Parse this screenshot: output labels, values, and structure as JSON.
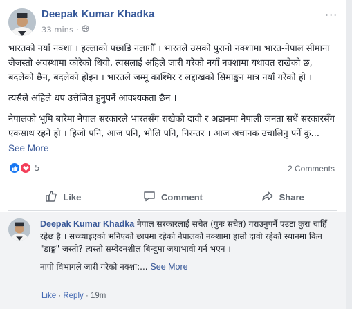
{
  "post": {
    "author": "Deepak Kumar Khadka",
    "time": "33 mins",
    "dot": "·",
    "menu": "···",
    "paragraphs": [
      "भारतको नयाँ नक्शा । हल्लाको पछाडि नलागौँ । भारतले उसको पुरानो नक्शामा भारत-नेपाल सीमाना जेजस्तो अवस्थामा कोरेको थियो, त्यसलाई अहिले जारी गरेको नयाँ नक्शामा यथावत राखेको छ, बदलेको छैन, बदलेको होइन । भारतले जम्मू काश्मिर र लद्दाखको सिमाङ्कन मात्र नयाँ गरेको हो ।",
      "त्यसैले अहिले थप उत्तेजित हुनुपर्ने आवश्यकता छैन ।",
      "नेपालको भूमि बारेमा नेपाल सरकारले भारतसँग राखेको दावी र अडानमा नेपाली जनता सधैं सरकारसँग एकसाथ रहने हो । हिजो पनि, आज पनि, भोलि पनि, निरन्तर । आज अचानक उचालिनु पर्ने कु..."
    ],
    "see_more": "See More",
    "reaction_count": "5",
    "comments_count": "2 Comments"
  },
  "actions": {
    "like": "Like",
    "comment": "Comment",
    "share": "Share"
  },
  "comment": {
    "author": "Deepak Kumar Khadka",
    "text1": "नेपाल सरकारलाई सचेत (पुनः सचेत) गराउनुपर्ने एउटा कुरा चाहिँ रहेछ है । सच्च्याइएको भनिएको छापमा रहेको नेपालको नक्शामा हाम्रो दावी रहेको स्थानमा किन \"डाङ्ग\" जस्तो? त्यस्तो सम्वेदनशील बिन्दुमा जथाभावी गर्न भएन ।",
    "text2": "नापी विभागले जारी गरेको नक्शा:...",
    "see_more": "See More",
    "like": "Like",
    "reply": "Reply",
    "sep": "·",
    "time": "19m"
  },
  "colors": {
    "link_blue": "#365899",
    "like_blue": "#1877f2",
    "love_red": "#f33e58",
    "muted": "#606770"
  },
  "icons": [
    "globe-icon",
    "like-reaction-icon",
    "love-reaction-icon",
    "thumbs-up-icon",
    "speech-bubble-icon",
    "share-arrow-icon",
    "more-options-icon"
  ]
}
